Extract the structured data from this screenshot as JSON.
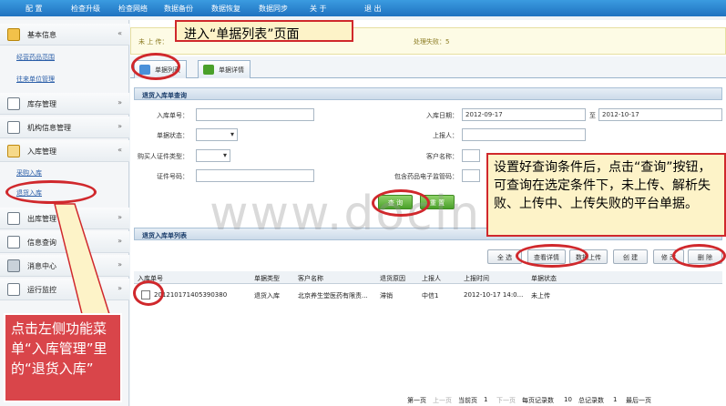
{
  "topnav": [
    "配 置",
    "检查升级",
    "检查网络",
    "数据备份",
    "数据恢复",
    "数据同步",
    "关 于",
    "退 出"
  ],
  "sidebar": {
    "groups": [
      {
        "label": "基本信息",
        "chev": "«",
        "icon": "basic-info-icon"
      },
      {
        "label": "库存管理",
        "chev": "»",
        "icon": "stock-icon"
      },
      {
        "label": "机构信息管理",
        "chev": "»",
        "icon": "org-icon"
      },
      {
        "label": "入库管理",
        "chev": "«",
        "icon": "inbound-icon"
      },
      {
        "label": "出库管理",
        "chev": "»",
        "icon": "outbound-icon"
      },
      {
        "label": "信息查询",
        "chev": "»",
        "icon": "query-icon"
      },
      {
        "label": "消息中心",
        "chev": "»",
        "icon": "message-icon"
      },
      {
        "label": "运行监控",
        "chev": "»",
        "icon": "monitor-icon"
      }
    ],
    "sub_basic": [
      "经营药品范围",
      "往来单位管理"
    ],
    "sub_inbound": [
      "采购入库",
      "退货入库"
    ]
  },
  "status": {
    "upload": "未 上 传：",
    "fail": "处理失败：5"
  },
  "tabs": [
    "单据列表",
    "单据详情"
  ],
  "query": {
    "title": "退货入库单查询",
    "labels": {
      "order_no": "入库单号：",
      "status": "单据状态：",
      "buyer_id_type": "购买人证件类型：",
      "id_no": "证件号码：",
      "date": "入库日期：",
      "reporter": "上报人：",
      "customer": "客户名称：",
      "drug_code": "包含药品电子监管码："
    },
    "date_from": "2012-09-17",
    "date_to_sep": "至",
    "date_to": "2012-10-17",
    "btn_query": "查 询",
    "btn_reset": "重 置"
  },
  "list": {
    "title": "退货入库单列表",
    "buttons": [
      "全 选",
      "查看详情",
      "数据上传",
      "创 建",
      "修 改",
      "删 除"
    ],
    "columns": [
      "入库单号",
      "单据类型",
      "客户名称",
      "退货原因",
      "上报人",
      "上报时间",
      "单据状态"
    ],
    "rows": [
      [
        "201210171405390380",
        "退货入库",
        "北京养生堂医药有限责...",
        "滞销",
        "中信1",
        "2012-10-17 14:0...",
        "未上传"
      ]
    ]
  },
  "pager": {
    "first": "第一页",
    "prev": "上一页",
    "current_label": "当前页",
    "current": "1",
    "next": "下一页",
    "per_page": "每页记录数",
    "per_page_val": "10",
    "total": "总记录数",
    "total_val": "1",
    "last": "最后一页"
  },
  "annotations": {
    "top": "进入“单据列表”页面",
    "right": "设置好查询条件后，点击“查询”按钮，可查询在选定条件下，未上传、解析失败、上传中、上传失败的平台单据。",
    "left": "点击左侧功能菜单“入库管理”里的“退货入库”"
  },
  "watermark": "www.docin.com",
  "colors": {
    "accent": "#1f72c0",
    "callout_border": "#d0282c",
    "callout_fill": "#fdf3c8",
    "note_fill": "#d9454a"
  }
}
